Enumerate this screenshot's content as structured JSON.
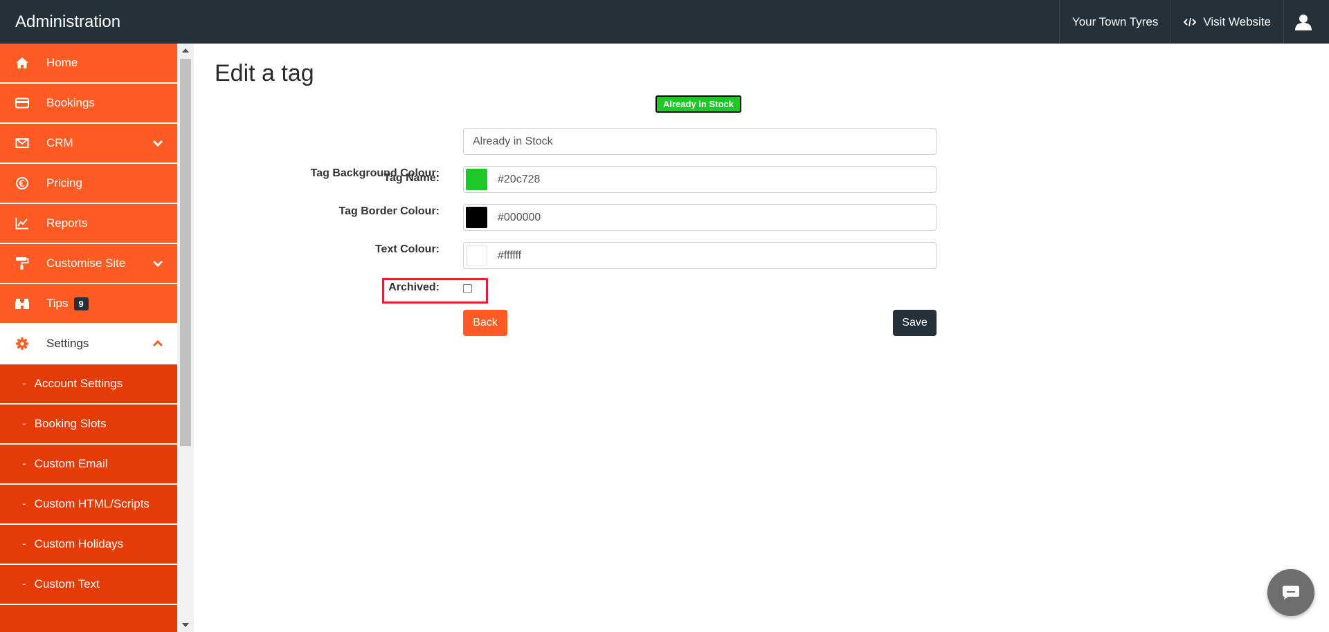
{
  "header": {
    "title": "Administration",
    "company": "Your Town Tyres",
    "visit_website": "Visit Website"
  },
  "sidebar": {
    "items": [
      {
        "label": "Home",
        "icon": "home-icon"
      },
      {
        "label": "Bookings",
        "icon": "credit-card-icon"
      },
      {
        "label": "CRM",
        "icon": "envelope-icon"
      },
      {
        "label": "Pricing",
        "icon": "euro-icon"
      },
      {
        "label": "Reports",
        "icon": "line-chart-icon"
      },
      {
        "label": "Customise Site",
        "icon": "paint-roller-icon"
      },
      {
        "label": "Tips",
        "icon": "binoculars-icon",
        "badge": "9"
      },
      {
        "label": "Settings",
        "icon": "gear-icon"
      }
    ],
    "sub_items": [
      {
        "label": "Account Settings"
      },
      {
        "label": "Booking Slots"
      },
      {
        "label": "Custom Email"
      },
      {
        "label": "Custom HTML/Scripts"
      },
      {
        "label": "Custom Holidays"
      },
      {
        "label": "Custom Text"
      }
    ],
    "sub_prefix": "-",
    "colors": {
      "menu": "#ff5b23",
      "submenu": "#e53c07",
      "header": "#263038"
    }
  },
  "main": {
    "title": "Edit a tag",
    "preview": {
      "label": "Already in Stock"
    },
    "form": {
      "tag_name_label": "Tag Name:",
      "tag_name_value": "Already in Stock",
      "bg_colour_label": "Tag Background Colour:",
      "bg_colour_value": "#20c728",
      "border_colour_label": "Tag Border Colour:",
      "border_colour_value": "#000000",
      "text_colour_label": "Text Colour:",
      "text_colour_value": "#ffffff",
      "archived_label": "Archived:",
      "archived_checked": false
    },
    "buttons": {
      "back": "Back",
      "save": "Save"
    }
  }
}
